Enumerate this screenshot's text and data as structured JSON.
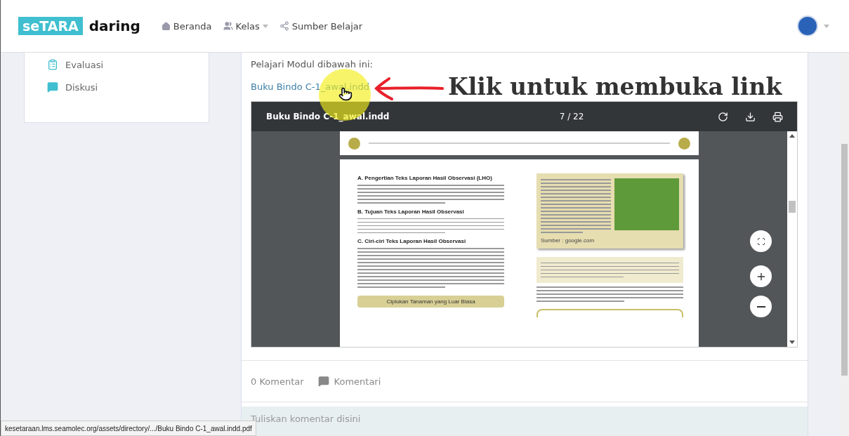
{
  "header": {
    "logo_box": "seTARA",
    "logo_text": "daring",
    "nav": [
      {
        "label": "Beranda",
        "kind": "home"
      },
      {
        "label": "Kelas",
        "kind": "group"
      },
      {
        "label": "Sumber Belajar",
        "kind": "share"
      }
    ]
  },
  "sidebar": {
    "items": [
      {
        "label": "Evaluasi",
        "kind": "clipboard"
      },
      {
        "label": "Diskusi",
        "kind": "chat"
      }
    ]
  },
  "content": {
    "intro": "Pelajari Modul dibawah ini:",
    "link": "Buku Bindo C-1_awal.indd"
  },
  "annotation": {
    "text": "Klik untuk membuka link"
  },
  "pdf_viewer": {
    "title": "Buku Bindo C-1_awal.indd",
    "page_indicator": "7  /  22",
    "document": {
      "sections": [
        {
          "heading": "A.  Pengertian Teks Laporan Hasil Observasi (LHO)"
        },
        {
          "heading": "B.  Tujuan Teks Laporan Hasil Observasi"
        },
        {
          "heading": "C.  Ciri-ciri Teks  Laporan Hasil Observasi"
        }
      ],
      "box_title": "Ciplukan Tanaman yang Luar Biasa",
      "source": "Sumber : google.com"
    }
  },
  "comments": {
    "count": "0 Komentar",
    "action": "Komentari",
    "placeholder": "Tuliskan komentar disini"
  },
  "status_bar": {
    "url": "kesetaraan.lms.seamolec.org/assets/directory/.../Buku Bindo C-1_awal.indd.pdf"
  }
}
